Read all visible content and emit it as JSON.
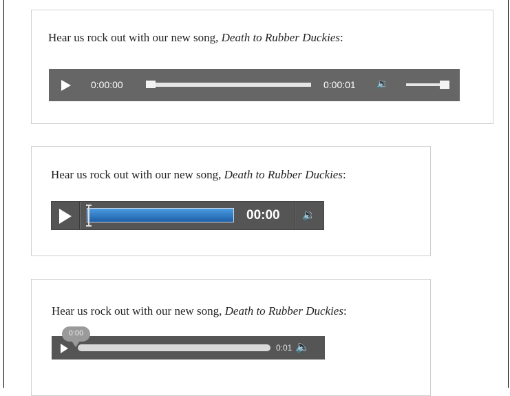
{
  "caption": {
    "prefix": "Hear us rock out with our new song, ",
    "song": "Death to Rubber Duckies",
    "suffix": ":"
  },
  "player_1": {
    "current_time": "0:00:00",
    "duration": "0:00:01",
    "progress": 0.0,
    "volume": 1.0,
    "icons": [
      "play-icon",
      "volume-icon"
    ]
  },
  "player_2": {
    "time": "00:00",
    "icons": [
      "play-icon",
      "volume-icon"
    ]
  },
  "player_3": {
    "tooltip_time": "0:00",
    "duration": "0:01",
    "icons": [
      "play-icon",
      "volume-icon"
    ]
  }
}
